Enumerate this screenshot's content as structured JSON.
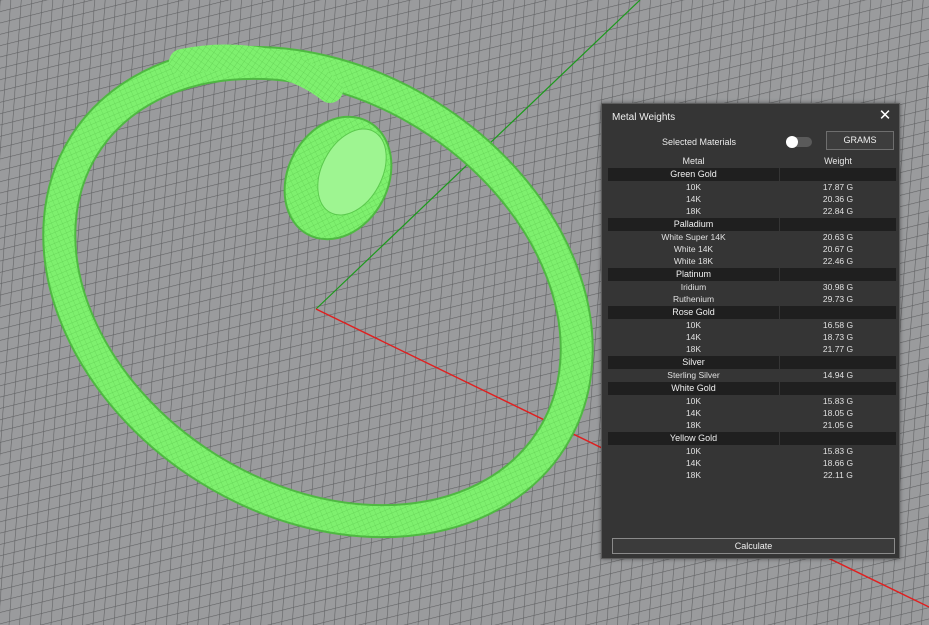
{
  "viewport": {
    "grid_color": "#5f6062",
    "background_color": "#9a9b9d",
    "model_color": "#7ef06e",
    "axis_x_color": "#e01f1f",
    "axis_y_color": "#1c9a1c"
  },
  "panel": {
    "title": "Metal Weights",
    "close_icon": "✕",
    "selected_materials_label": "Selected Materials",
    "unit_button_label": "GRAMS",
    "col_metal": "Metal",
    "col_weight": "Weight",
    "calculate_label": "Calculate",
    "groups": [
      {
        "name": "Green Gold",
        "items": [
          {
            "name": "10K",
            "weight": "17.87 G"
          },
          {
            "name": "14K",
            "weight": "20.36 G"
          },
          {
            "name": "18K",
            "weight": "22.84 G"
          }
        ]
      },
      {
        "name": "Palladium",
        "items": [
          {
            "name": "White Super 14K",
            "weight": "20.63 G"
          },
          {
            "name": "White 14K",
            "weight": "20.67 G"
          },
          {
            "name": "White 18K",
            "weight": "22.46 G"
          }
        ]
      },
      {
        "name": "Platinum",
        "items": [
          {
            "name": "Iridium",
            "weight": "30.98 G"
          },
          {
            "name": "Ruthenium",
            "weight": "29.73 G"
          }
        ]
      },
      {
        "name": "Rose Gold",
        "items": [
          {
            "name": "10K",
            "weight": "16.58 G"
          },
          {
            "name": "14K",
            "weight": "18.73 G"
          },
          {
            "name": "18K",
            "weight": "21.77 G"
          }
        ]
      },
      {
        "name": "Silver",
        "items": [
          {
            "name": "Sterling Silver",
            "weight": "14.94 G"
          }
        ]
      },
      {
        "name": "White Gold",
        "items": [
          {
            "name": "10K",
            "weight": "15.83 G"
          },
          {
            "name": "14K",
            "weight": "18.05 G"
          },
          {
            "name": "18K",
            "weight": "21.05 G"
          }
        ]
      },
      {
        "name": "Yellow Gold",
        "items": [
          {
            "name": "10K",
            "weight": "15.83 G"
          },
          {
            "name": "14K",
            "weight": "18.66 G"
          },
          {
            "name": "18K",
            "weight": "22.11 G"
          }
        ]
      }
    ]
  }
}
